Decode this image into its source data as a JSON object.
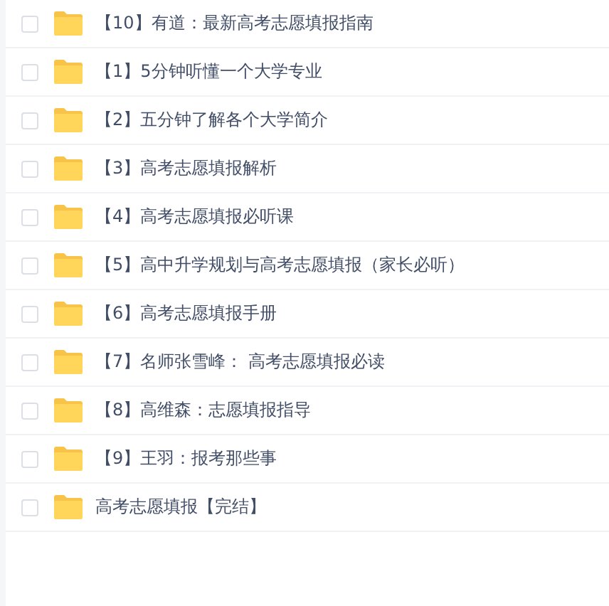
{
  "files": [
    {
      "name": "【10】有道：最新高考志愿填报指南",
      "checked": false
    },
    {
      "name": "【1】5分钟听懂一个大学专业",
      "checked": false
    },
    {
      "name": "【2】五分钟了解各个大学简介",
      "checked": false
    },
    {
      "name": "【3】高考志愿填报解析",
      "checked": false
    },
    {
      "name": "【4】高考志愿填报必听课",
      "checked": false
    },
    {
      "name": "【5】高中升学规划与高考志愿填报（家长必听）",
      "checked": false
    },
    {
      "name": "【6】高考志愿填报手册",
      "checked": false
    },
    {
      "name": "【7】名师张雪峰： 高考志愿填报必读",
      "checked": false
    },
    {
      "name": "【8】高维森：志愿填报指导",
      "checked": false
    },
    {
      "name": "【9】王羽：报考那些事",
      "checked": false
    },
    {
      "name": "高考志愿填报【完结】",
      "checked": false
    }
  ]
}
